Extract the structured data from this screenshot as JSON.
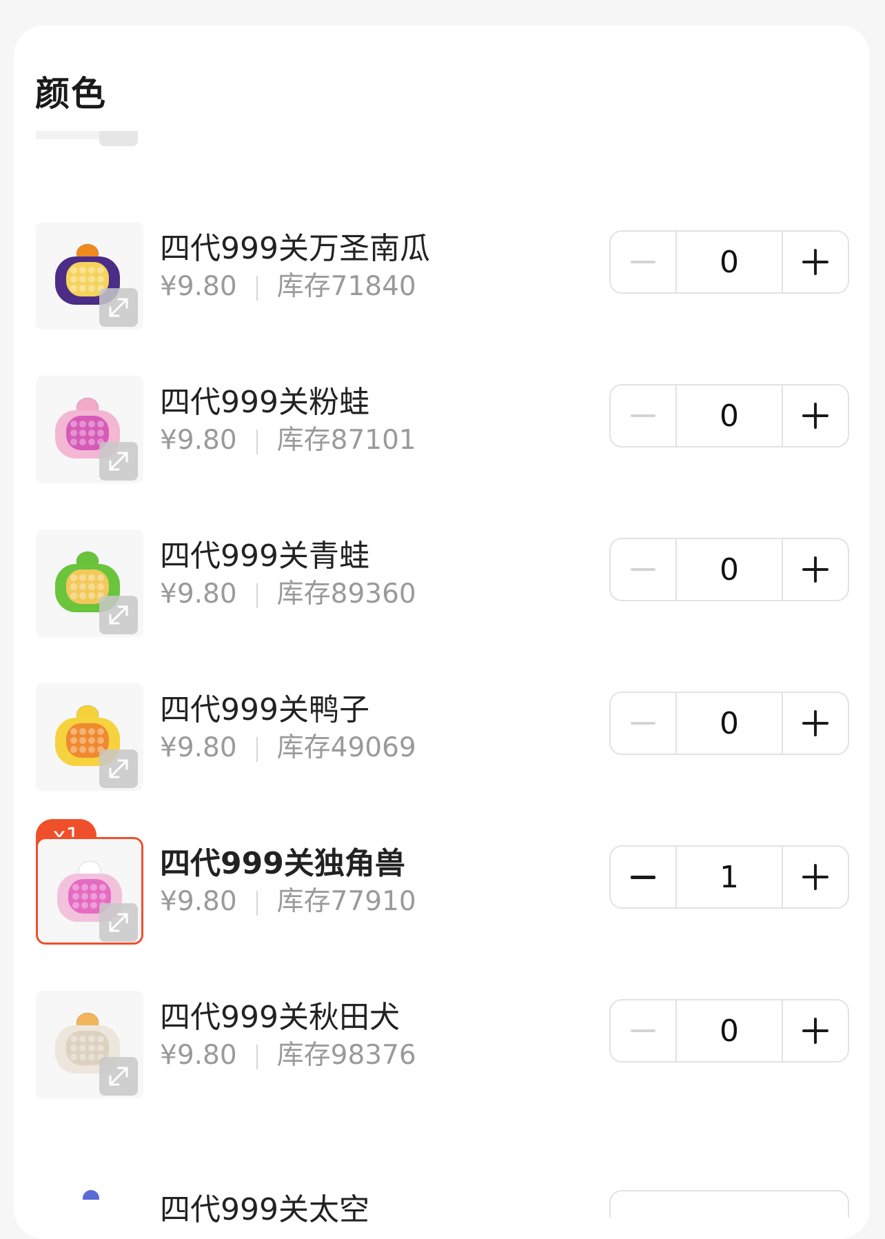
{
  "section": {
    "title": "颜色"
  },
  "items": [
    {
      "name": "四代999关万圣南瓜",
      "price": "¥9.80",
      "stock": "库存71840",
      "qty": "0",
      "selected": false,
      "body_color": "#4b2c86",
      "pad_color": "#f5d35b",
      "top_color": "#ef8a1e"
    },
    {
      "name": "四代999关粉蛙",
      "price": "¥9.80",
      "stock": "库存87101",
      "qty": "0",
      "selected": false,
      "body_color": "#f3b6d3",
      "pad_color": "#d65ab7",
      "top_color": "#f3a9c8"
    },
    {
      "name": "四代999关青蛙",
      "price": "¥9.80",
      "stock": "库存89360",
      "qty": "0",
      "selected": false,
      "body_color": "#6ac43c",
      "pad_color": "#f2c95a",
      "top_color": "#69c33a"
    },
    {
      "name": "四代999关鸭子",
      "price": "¥9.80",
      "stock": "库存49069",
      "qty": "0",
      "selected": false,
      "body_color": "#f7d23f",
      "pad_color": "#ef8a2e",
      "top_color": "#f5d23a"
    },
    {
      "name": "四代999关独角兽",
      "price": "¥9.80",
      "stock": "库存77910",
      "qty": "1",
      "selected": true,
      "badge": "x1",
      "body_color": "#f2c2dc",
      "pad_color": "#e56bc2",
      "top_color": "#ffffff"
    },
    {
      "name": "四代999关秋田犬",
      "price": "¥9.80",
      "stock": "库存98376",
      "qty": "0",
      "selected": false,
      "body_color": "#ece6dc",
      "pad_color": "#ddd1bf",
      "top_color": "#f2b35a"
    }
  ],
  "partial_next_item": {
    "name": "四代999关太空"
  }
}
